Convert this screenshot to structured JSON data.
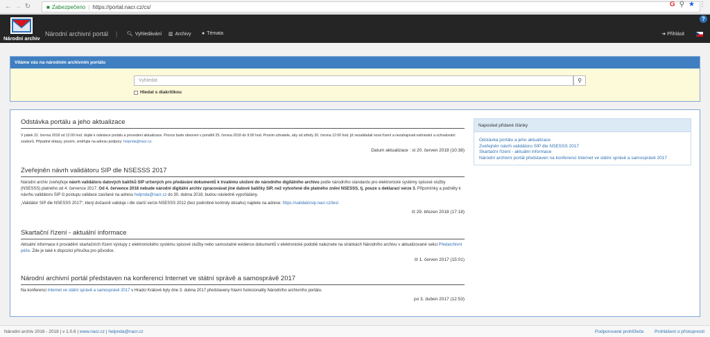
{
  "browser": {
    "secure_label": "Zabezpečeno",
    "url": "https://portal.nacr.cz/cs/"
  },
  "navbar": {
    "logo_text": "Národní archiv",
    "brand": "Národní archivní portál",
    "divider": "|",
    "search": "Vyhledávání",
    "archives": "Archivy",
    "topics": "Témata",
    "login": "Přihlásit",
    "help": "?"
  },
  "welcome": {
    "heading": "Vítáme vás na národním archivním portálu",
    "search_placeholder": "Vyhledat",
    "diacritics": "Hledat s diakritikou"
  },
  "articles": [
    {
      "title": "Odstávka portálu a jeho aktualizace",
      "body": "V pátek 22. června 2018 od 12:00 hod. dojde k odstávce portálu a provedení aktualizace. Provoz bude obnoven v pondělí 25. června 2018 do 9:00 hod. Prosím uživatele, aby od středy 20. června 12:00 hod. již nezakládali nová řízení a nezahajovali nahrávání a schvalování souborů. Případné dotazy, prosím, směřujte na adresu podpory:",
      "body_link": "helpnda@nacr.cz",
      "body_end": ".",
      "date": "Datum aktualizace : st 20. červen 2018 (10:38)"
    },
    {
      "title": "Zveřejněn návrh validátoru SIP dle NSESSS 2017",
      "p1_a": "Národní archiv zveřejňuje ",
      "p1_b": "návrh validátoru datových balíčků SIP určených pro předávání dokumentů k trvalému uložení do národního digitálního archivu",
      "p1_c": " podle národního standardu pro elektronické systémy spisové služby (NSESSS) platného od 4. července 2017. ",
      "p1_d": "Od 4. července 2018 nebude národní digitální archiv zpracovávat jiné datové balíčky SIP, než vytvořené dle platného znění NSESSS, tj. pouze s deklarací verze 3.",
      "p1_e": " Připomínky a podněty k návrhu validátoru SIP či postupu validace zasílané na adresu ",
      "p1_link": "helpnda@nacr.cz",
      "p1_f": " do 30. dubna 2018, budou následně vypořádány.",
      "p2_a": "„Validátor SIP dle NSESSS 2017“, který dočasně validuje i dle starší verze NSESSS 2012 (bez podrobné kontroly obsahu) najdete na adrese: ",
      "p2_link": "https://validatorsip.nacr.cz/test",
      "date": "čt 29. březen 2018 (17:18)"
    },
    {
      "title": "Skartační řízení - aktuální informace",
      "body_a": "Aktuální informace k provádění skartačních řízení výstupy z elektronického systému spisové služby nebo samostatné evidence dokumentů v elektronické podobě naleznete na stránkách Národního archivu v aktualizované sekci ",
      "body_link": "Předarchivní péče",
      "body_b": ". Zde je také k dispozici příručka pro původce.",
      "date": "čt 1. červen 2017 (15:01)"
    },
    {
      "title": "Národní archivní portál představen na konferenci Internet ve státní správě a samosprávě 2017",
      "body_a": "Na konferenci ",
      "body_link": "Internet ve státní správě a samosprávě 2017",
      "body_b": " v Hradci Králové byly dne 3. dubna 2017 představeny hlavní funkcionality Národního archivního portálu.",
      "date": "po 3. duben 2017 (12:53)"
    }
  ],
  "sidebar": {
    "heading": "Naposled přidané články",
    "links": [
      "Odstávka portálu a jeho aktualizace",
      "Zveřejněn návrh validátoru SIP dle NSESSS 2017",
      "Skartační řízení - aktuální informace",
      "Národní archivní portál představen na konferenci Internet ve státní správě a samosprávě 2017"
    ]
  },
  "footer": {
    "left_text": "Národní archiv 2016 - 2018 | v 1.0.6 | ",
    "link1": "www.nacr.cz",
    "mid": " | ",
    "link2": "helpnda@nacr.cz",
    "supported": "Podporované prohlížeče",
    "accessibility": "Prohlášení o přístupnosti"
  },
  "colors": {
    "accent": "#3f7fc1",
    "navbar": "#252525",
    "welcome_bg": "#fcfad9",
    "link": "#2d6fb3"
  }
}
